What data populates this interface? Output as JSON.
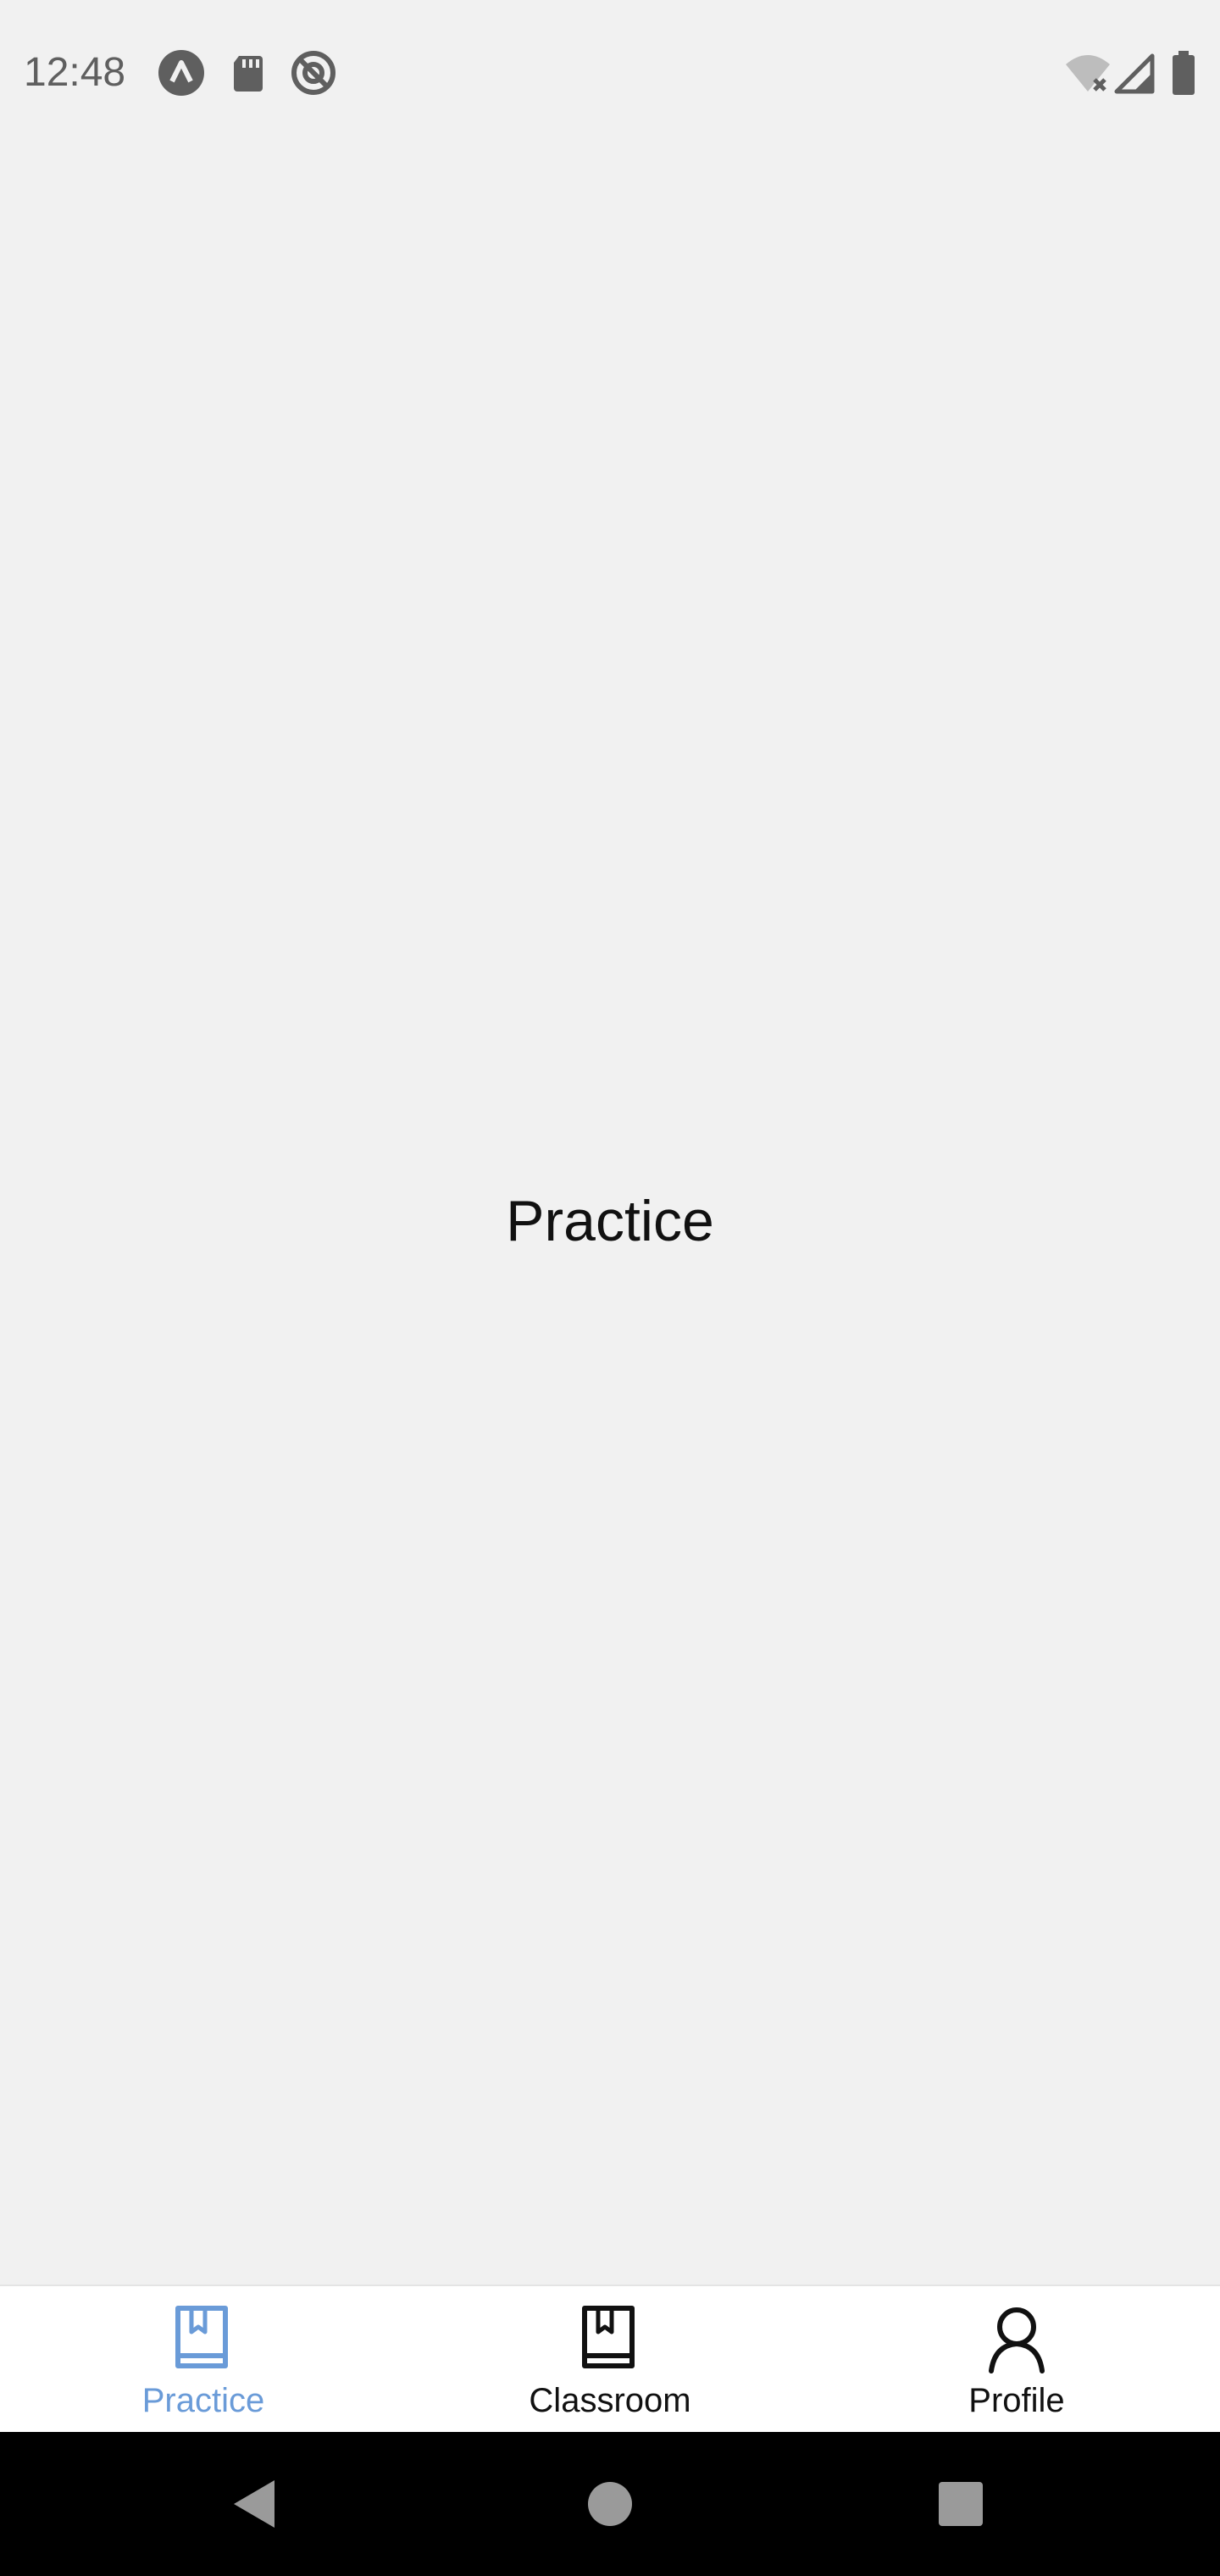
{
  "status_bar": {
    "time": "12:48",
    "left_icons": [
      "app-notification-icon",
      "sd-card-icon",
      "do-not-disturb-icon"
    ],
    "right_icons": [
      "wifi-off-icon",
      "cell-signal-icon",
      "battery-icon"
    ],
    "icon_color": "#5f5f5f"
  },
  "main": {
    "title": "Practice"
  },
  "tab_bar": {
    "active_color": "#6a9bd8",
    "inactive_color": "#111111",
    "tabs": [
      {
        "label": "Practice",
        "icon": "book-icon",
        "active": true
      },
      {
        "label": "Classroom",
        "icon": "book-icon",
        "active": false
      },
      {
        "label": "Profile",
        "icon": "person-icon",
        "active": false
      }
    ]
  },
  "nav_bar": {
    "buttons": [
      "back-button",
      "home-button",
      "recents-button"
    ],
    "button_color": "#9a9a9a"
  }
}
